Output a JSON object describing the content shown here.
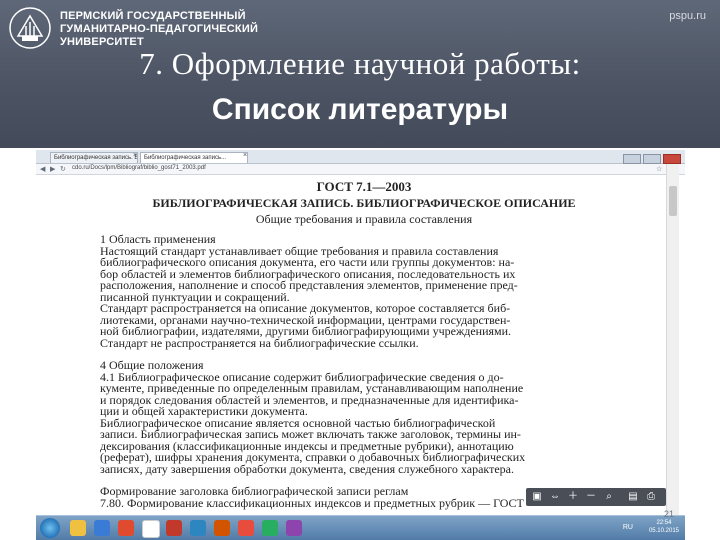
{
  "header": {
    "university_lines": [
      "ПЕРМСКИЙ ГОСУДАРСТВЕННЫЙ",
      "ГУМАНИТАРНО-ПЕДАГОГИЧЕСКИЙ",
      "УНИВЕРСИТЕТ"
    ],
    "site": "pspu.ru",
    "title_line1": "7. Оформление научной работы:",
    "title_line2": "Список литературы"
  },
  "colors": {
    "banner": "#4d5565",
    "taskbar": "#4f7aa6"
  },
  "document": {
    "title": "ГОСТ 7.1—2003",
    "subtitle": "БИБЛИОГРАФИЧЕСКАЯ ЗАПИСЬ. БИБЛИОГРАФИЧЕСКОЕ ОПИСАНИЕ",
    "subtitle2": "Общие требования и правила составления",
    "lines": [
      "1 Область применения",
      "Настоящий стандарт устанавливает общие требования и правила составления",
      "библиографического описания документа, его части или группы документов: на-",
      "бор областей и элементов библиографического описания, последовательность их",
      "расположения, наполнение и способ представления элементов, применение пред-",
      "писанной пунктуации и сокращений.",
      "Стандарт распространяется на описание документов, которое составляется биб-",
      "лиотеками, органами научно-технической информации, центрами государствен-",
      "ной библиографии, издателями, другими библиографирующими учреждениями.",
      "Стандарт не распространяется на библиографические ссылки.",
      "4 Общие положения",
      "4.1 Библиографическое описание содержит библиографические сведения о до-",
      "кументе, приведенные по определенным правилам, устанавливающим наполнение",
      "и порядок следования областей и элементов, и предназначенные для идентифика-",
      "ции и общей характеристики документа.",
      "Библиографическое описание является основной частью библиографической",
      "записи. Библиографическая запись может включать также заголовок, термины ин-",
      "дексирования (классификационные индексы и предметные рубрики), аннотацию",
      "(реферат), шифры хранения документа, справки о добавочных библиографических",
      "записях, дату завершения обработки документа, сведения служебного характера.",
      "Формирование заголовка библиографической записи реглам",
      "7.80. Формирование классификационных индексов и предметных рубрик — ГОСТ"
    ]
  },
  "browser": {
    "tab1": "Библиографическая запись. Библиогр...",
    "tab2": "Библиографическая запись...",
    "url": "cdo.ru/Docs/lpm/Bibliograf/biblio_gost71_2003.pdf"
  },
  "taskbar": {
    "lang": "RU",
    "time": "22:54",
    "date": "05.10.2015"
  },
  "page_number": "21"
}
